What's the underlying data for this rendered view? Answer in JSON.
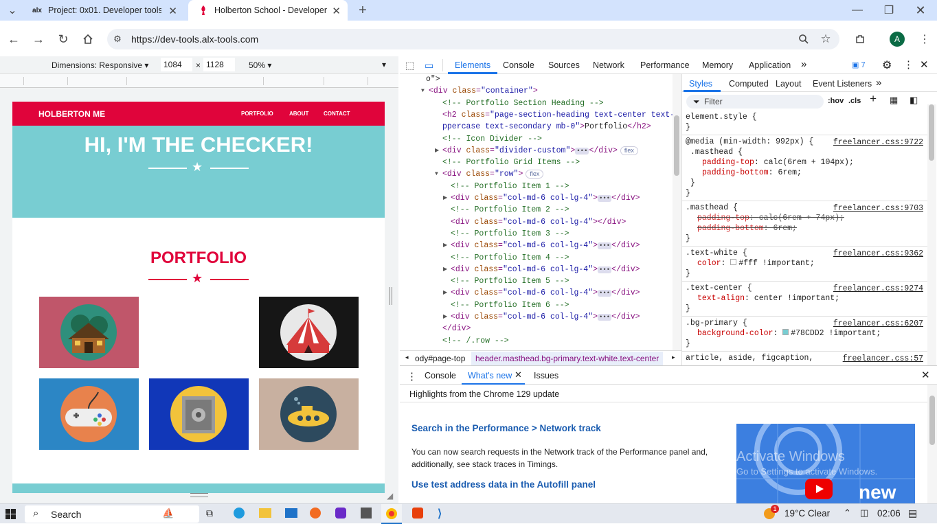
{
  "browser": {
    "tabs": [
      {
        "favicon": "alx",
        "title": "Project: 0x01. Developer tools |"
      },
      {
        "favicon": "holberton-icon",
        "title": "Holberton School - Developer t"
      }
    ],
    "url": "https://dev-tools.alx-tools.com",
    "profile_initial": "A"
  },
  "device_toolbar": {
    "dimensions_label": "Dimensions: Responsive",
    "width": "1084",
    "height": "1128",
    "times": "×",
    "zoom": "50%"
  },
  "page": {
    "brand": "HOLBERTON ME",
    "nav": [
      "PORTFOLIO",
      "ABOUT",
      "CONTACT"
    ],
    "hero_title": "HI, I'M THE CHECKER!",
    "section_title": "PORTFOLIO",
    "colors": {
      "nav": "#e0043b",
      "masthead": "#78CDD2",
      "accent": "#e0043b"
    },
    "portfolio": [
      {
        "icon": "cabin-icon",
        "bg": "#c0566a"
      },
      {
        "icon": "circus-tent-icon",
        "bg": "#161616"
      },
      {
        "icon": "game-controller-icon",
        "bg": "#2c86c5"
      },
      {
        "icon": "safe-icon",
        "bg": "#1137b8"
      },
      {
        "icon": "submarine-icon",
        "bg": "#c8b0a0"
      }
    ]
  },
  "devtools": {
    "tabs": [
      "Elements",
      "Console",
      "Sources",
      "Network",
      "Performance",
      "Memory",
      "Application"
    ],
    "issues_count": "7",
    "elements_lines": [
      {
        "i": 0,
        "t": "o\">"
      },
      {
        "i": 1,
        "open": true,
        "tag": "div",
        "attr": "class",
        "val": "container"
      },
      {
        "i": 2,
        "comment": "<!-- Portfolio Section Heading -->"
      },
      {
        "i": 2,
        "raw1": "<h2 class=\"page-section-heading text-center text-u"
      },
      {
        "i": 2,
        "raw2": "ppercase text-secondary mb-0\">Portfolio</h2>"
      },
      {
        "i": 2,
        "comment": "<!-- Icon Divider -->"
      },
      {
        "i": 2,
        "closed": true,
        "tag": "div",
        "attr": "class",
        "val": "divider-custom",
        "badge": "flex"
      },
      {
        "i": 2,
        "comment": "<!-- Portfolio Grid Items -->"
      },
      {
        "i": 2,
        "open": true,
        "tag": "div",
        "attr": "class",
        "val": "row",
        "badge": "flex",
        "noclose": true
      },
      {
        "i": 3,
        "comment": "<!-- Portfolio Item 1 -->"
      },
      {
        "i": 3,
        "closed": true,
        "tag": "div",
        "attr": "class",
        "val": "col-md-6 col-lg-4"
      },
      {
        "i": 3,
        "comment": "<!-- Portfolio Item 2 -->"
      },
      {
        "i": 3,
        "empty": true,
        "tag": "div",
        "attr": "class",
        "val": "col-md-6 col-lg-4"
      },
      {
        "i": 3,
        "comment": "<!-- Portfolio Item 3 -->"
      },
      {
        "i": 3,
        "closed": true,
        "tag": "div",
        "attr": "class",
        "val": "col-md-6 col-lg-4"
      },
      {
        "i": 3,
        "comment": "<!-- Portfolio Item 4 -->"
      },
      {
        "i": 3,
        "closed": true,
        "tag": "div",
        "attr": "class",
        "val": "col-md-6 col-lg-4"
      },
      {
        "i": 3,
        "comment": "<!-- Portfolio Item 5 -->"
      },
      {
        "i": 3,
        "closed": true,
        "tag": "div",
        "attr": "class",
        "val": "col-md-6 col-lg-4"
      },
      {
        "i": 3,
        "comment": "<!-- Portfolio Item 6 -->"
      },
      {
        "i": 3,
        "closed": true,
        "tag": "div",
        "attr": "class",
        "val": "col-md-6 col-lg-4"
      },
      {
        "i": 2,
        "endtag": "</div>"
      },
      {
        "i": 2,
        "comment": "<!-- /.row -->"
      }
    ],
    "breadcrumbs": [
      "ody#page-top",
      "header.masthead.bg-primary.text-white.text-center"
    ],
    "styles_tabs": [
      "Styles",
      "Computed",
      "Layout",
      "Event Listeners"
    ],
    "filter_placeholder": "Filter",
    "hov": ":hov",
    "cls": ".cls",
    "rules": [
      {
        "selector": "element.style {",
        "source": "",
        "props": []
      },
      {
        "selector": "@media (min-width: 992px) {",
        "selector2": ".masthead {",
        "source": "freelancer.css:9722",
        "props": [
          {
            "n": "padding-top",
            "v": "calc(6rem + 104px);"
          },
          {
            "n": "padding-bottom",
            "v": "6rem;"
          }
        ]
      },
      {
        "selector": ".masthead {",
        "source": "freelancer.css:9703",
        "props": [
          {
            "n": "padding-top",
            "v": "calc(6rem + 74px);",
            "struck": true
          },
          {
            "n": "padding-bottom",
            "v": "6rem;",
            "struck": true
          }
        ]
      },
      {
        "selector": ".text-white {",
        "source": "freelancer.css:9362",
        "props": [
          {
            "n": "color",
            "v": "#fff !important;",
            "swatch": "#ffffff"
          }
        ]
      },
      {
        "selector": ".text-center {",
        "source": "freelancer.css:9274",
        "props": [
          {
            "n": "text-align",
            "v": "center !important;"
          }
        ]
      },
      {
        "selector": ".bg-primary {",
        "source": "freelancer.css:6207",
        "props": [
          {
            "n": "background-color",
            "v": "#78CDD2 !important;",
            "swatch": "#78CDD2"
          }
        ]
      },
      {
        "selector": "article, aside, figcaption,",
        "source": "freelancer.css:57",
        "props": []
      }
    ],
    "drawer_tabs": [
      "Console",
      "What's new",
      "Issues"
    ],
    "whats_new_header": "Highlights from the Chrome 129 update",
    "news": [
      {
        "title": "Search in the Performance > Network track",
        "body": "You can now search requests in the Network track of the Performance panel and, additionally, see stack traces in Timings."
      },
      {
        "title": "Use test address data in the Autofill panel",
        "body": ""
      }
    ],
    "video_word": "new",
    "watermark1": "Activate Windows",
    "watermark2": "Go to Settings to activate Windows."
  },
  "taskbar": {
    "search": "Search",
    "weather": "19°C  Clear",
    "time": "02:06",
    "notif": "1"
  }
}
